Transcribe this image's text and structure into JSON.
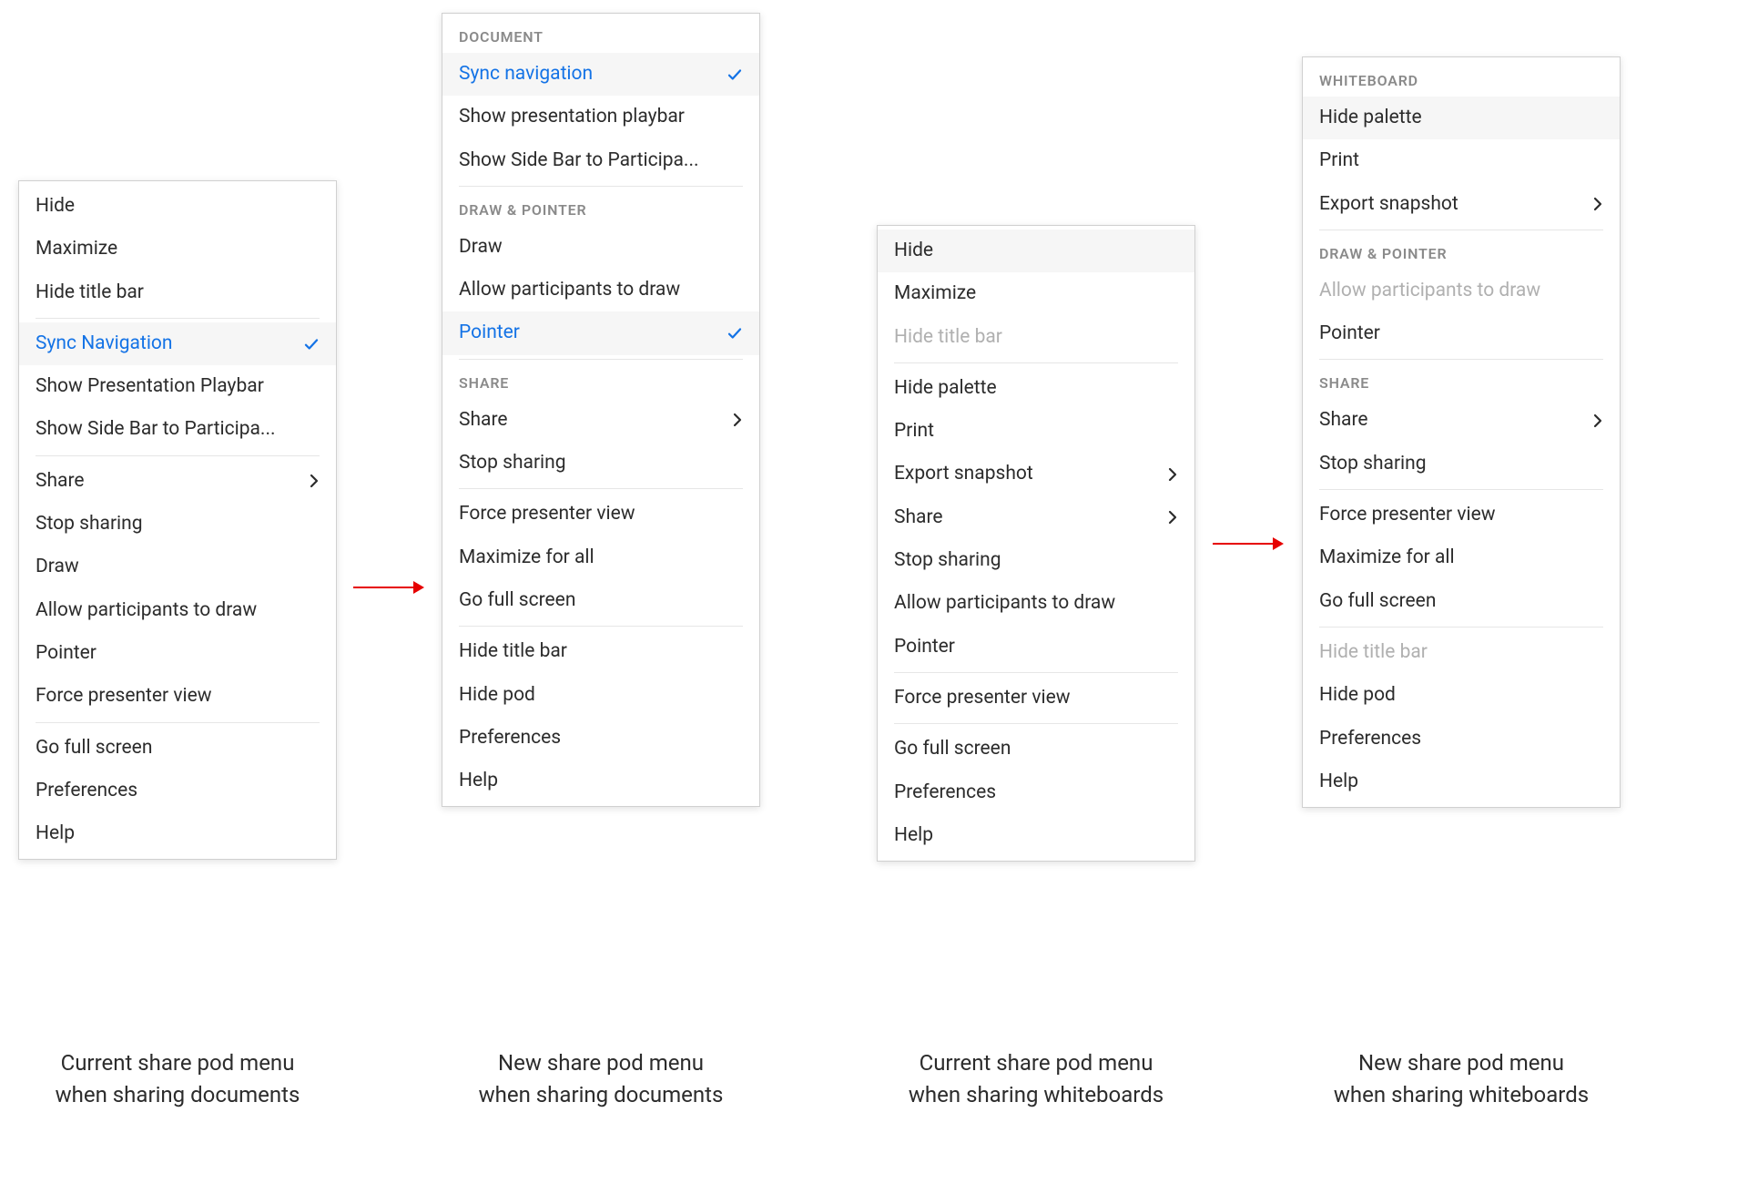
{
  "colors": {
    "accent": "#1473e6",
    "arrow": "#e60000"
  },
  "menus": {
    "docCurrent": {
      "caption": "Current share pod menu\nwhen sharing documents",
      "groups": [
        {
          "items": [
            {
              "label": "Hide"
            },
            {
              "label": "Maximize"
            },
            {
              "label": "Hide title bar"
            }
          ]
        },
        {
          "items": [
            {
              "label": "Sync Navigation",
              "selected": true,
              "checked": true
            },
            {
              "label": "Show Presentation Playbar"
            },
            {
              "label": "Show Side Bar to Participa..."
            }
          ]
        },
        {
          "items": [
            {
              "label": "Share",
              "submenu": true
            },
            {
              "label": "Stop sharing"
            },
            {
              "label": "Draw"
            },
            {
              "label": "Allow participants to draw"
            },
            {
              "label": "Pointer"
            },
            {
              "label": "Force presenter view"
            }
          ]
        },
        {
          "items": [
            {
              "label": "Go full screen"
            },
            {
              "label": "Preferences"
            },
            {
              "label": "Help"
            }
          ]
        }
      ]
    },
    "docNew": {
      "caption": "New share pod menu\nwhen sharing documents",
      "groups": [
        {
          "header": "DOCUMENT",
          "items": [
            {
              "label": "Sync navigation",
              "selected": true,
              "checked": true
            },
            {
              "label": "Show presentation playbar"
            },
            {
              "label": "Show Side Bar to Participa..."
            }
          ]
        },
        {
          "header": "DRAW & POINTER",
          "items": [
            {
              "label": "Draw"
            },
            {
              "label": "Allow participants to draw"
            },
            {
              "label": "Pointer",
              "selected": true,
              "checked": true
            }
          ]
        },
        {
          "header": "SHARE",
          "items": [
            {
              "label": "Share",
              "submenu": true
            },
            {
              "label": "Stop sharing"
            }
          ]
        },
        {
          "items": [
            {
              "label": "Force presenter view"
            },
            {
              "label": "Maximize for all"
            },
            {
              "label": "Go full screen"
            }
          ]
        },
        {
          "items": [
            {
              "label": "Hide title bar"
            },
            {
              "label": "Hide pod"
            },
            {
              "label": "Preferences"
            },
            {
              "label": "Help"
            }
          ]
        }
      ]
    },
    "wbCurrent": {
      "caption": "Current share pod menu\nwhen sharing whiteboards",
      "groups": [
        {
          "items": [
            {
              "label": "Hide",
              "highlighted": true
            },
            {
              "label": "Maximize"
            },
            {
              "label": "Hide title bar",
              "disabled": true
            }
          ]
        },
        {
          "items": [
            {
              "label": "Hide palette"
            },
            {
              "label": "Print"
            },
            {
              "label": "Export snapshot",
              "submenu": true
            },
            {
              "label": "Share",
              "submenu": true
            },
            {
              "label": "Stop sharing"
            },
            {
              "label": "Allow participants to draw"
            },
            {
              "label": "Pointer"
            }
          ]
        },
        {
          "items": [
            {
              "label": "Force presenter view"
            }
          ]
        },
        {
          "items": [
            {
              "label": "Go full screen"
            },
            {
              "label": "Preferences"
            },
            {
              "label": "Help"
            }
          ]
        }
      ]
    },
    "wbNew": {
      "caption": "New share pod menu\nwhen sharing whiteboards",
      "groups": [
        {
          "header": "WHITEBOARD",
          "items": [
            {
              "label": "Hide palette",
              "highlighted": true
            },
            {
              "label": "Print"
            },
            {
              "label": "Export snapshot",
              "submenu": true
            }
          ]
        },
        {
          "header": "DRAW & POINTER",
          "items": [
            {
              "label": "Allow participants to draw",
              "disabled": true
            },
            {
              "label": "Pointer"
            }
          ]
        },
        {
          "header": "SHARE",
          "items": [
            {
              "label": "Share",
              "submenu": true
            },
            {
              "label": "Stop sharing"
            }
          ]
        },
        {
          "items": [
            {
              "label": "Force presenter view"
            },
            {
              "label": "Maximize for all"
            },
            {
              "label": "Go full screen"
            }
          ]
        },
        {
          "items": [
            {
              "label": "Hide title bar",
              "disabled": true
            },
            {
              "label": "Hide pod"
            },
            {
              "label": "Preferences"
            },
            {
              "label": "Help"
            }
          ]
        }
      ]
    }
  }
}
